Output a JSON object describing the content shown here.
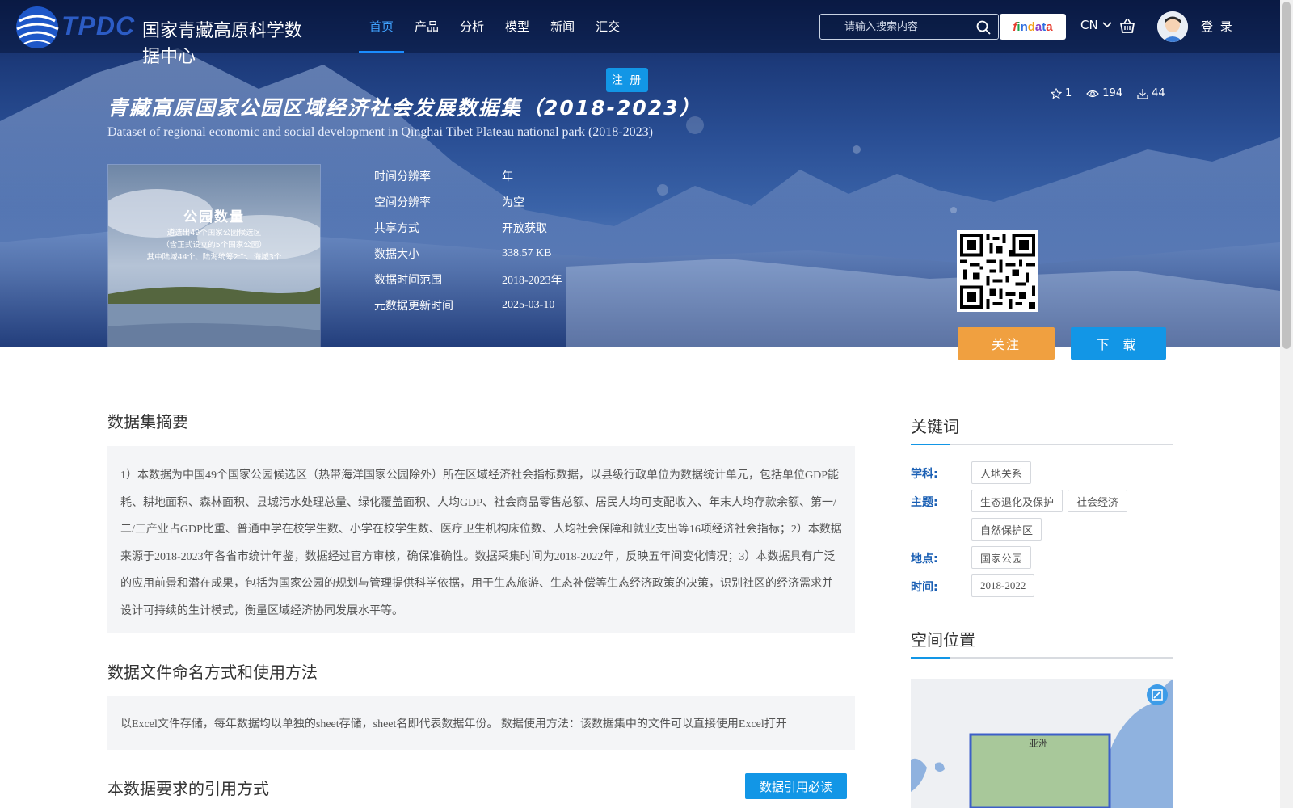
{
  "header": {
    "logo_abbr": "TPDC",
    "logo_name": "国家青藏高原科学数据中心",
    "nav": [
      "首页",
      "产品",
      "分析",
      "模型",
      "新闻",
      "汇交"
    ],
    "search_placeholder": "请输入搜索内容",
    "findata": [
      "f",
      "i",
      "n",
      "d",
      "a",
      "t",
      "a"
    ],
    "lang": "CN",
    "login": "登 录",
    "register": "注 册"
  },
  "stats": {
    "favorites": "1",
    "views": "194",
    "downloads": "44"
  },
  "dataset": {
    "title_cn": "青藏高原国家公园区域经济社会发展数据集（2018-2023）",
    "title_en": "Dataset of regional economic and social development in Qinghai Tibet Plateau national park (2018-2023)",
    "cover": {
      "title": "公园数量",
      "lines": [
        "遴选出49个国家公园候选区",
        "（含正式设立的5个国家公园）",
        "其中陆域44个、陆海统筹2个、海域3个"
      ]
    },
    "meta": [
      {
        "key": "时间分辨率",
        "value": "年"
      },
      {
        "key": "空间分辨率",
        "value": "为空"
      },
      {
        "key": "共享方式",
        "value": "开放获取"
      },
      {
        "key": "数据大小",
        "value": "338.57 KB"
      },
      {
        "key": "数据时间范围",
        "value": "2018-2023年"
      },
      {
        "key": "元数据更新时间",
        "value": "2025-03-10"
      }
    ],
    "follow_label": "关注",
    "download_label": "下 载"
  },
  "main": {
    "abstract_title": "数据集摘要",
    "abstract_text": "1）本数据为中国49个国家公园候选区（热带海洋国家公园除外）所在区域经济社会指标数据，以县级行政单位为数据统计单元，包括单位GDP能耗、耕地面积、森林面积、县城污水处理总量、绿化覆盖面积、人均GDP、社会商品零售总额、居民人均可支配收入、年末人均存款余额、第一/二/三产业占GDP比重、普通中学在校学生数、小学在校学生数、医疗卫生机构床位数、人均社会保障和就业支出等16项经济社会指标；2）本数据来源于2018-2023年各省市统计年鉴，数据经过官方审核，确保准确性。数据采集时间为2018-2022年，反映五年间变化情况；3）本数据具有广泛的应用前景和潜在成果，包括为国家公园的规划与管理提供科学依据，用于生态旅游、生态补偿等生态经济政策的决策，识别社区的经济需求并设计可持续的生计模式，衡量区域经济协同发展水平等。",
    "file_title": "数据文件命名方式和使用方法",
    "file_text": "以Excel文件存储，每年数据均以单独的sheet存储，sheet名即代表数据年份。 数据使用方法：该数据集中的文件可以直接使用Excel打开",
    "cite_title": "本数据要求的引用方式",
    "cite_button": "数据引用必读"
  },
  "sidebar": {
    "keywords_title": "关键词",
    "keywords": [
      {
        "label": "学科:",
        "tags": [
          "人地关系"
        ]
      },
      {
        "label": "主题:",
        "tags": [
          "生态退化及保护",
          "社会经济",
          "自然保护区"
        ]
      },
      {
        "label": "地点:",
        "tags": [
          "国家公园"
        ]
      },
      {
        "label": "时间:",
        "tags": [
          "2018-2022"
        ]
      }
    ],
    "location_title": "空间位置",
    "map_label": "亚洲"
  }
}
